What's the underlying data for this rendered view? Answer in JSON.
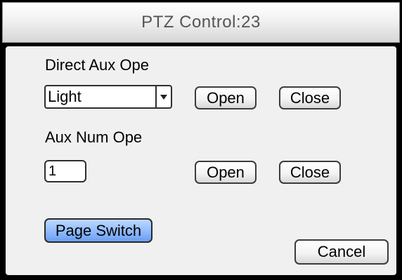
{
  "window": {
    "title": "PTZ Control:23"
  },
  "direct_aux": {
    "heading": "Direct Aux Ope",
    "selected_value": "Light",
    "open_label": "Open",
    "close_label": "Close"
  },
  "aux_num": {
    "heading": "Aux Num Ope",
    "number_value": "1",
    "open_label": "Open",
    "close_label": "Close"
  },
  "footer": {
    "page_switch_label": "Page Switch",
    "cancel_label": "Cancel"
  },
  "colors": {
    "highlight": "#8fbaff",
    "frame": "#000000",
    "panel": "#f0f0f0"
  },
  "icons": {
    "dropdown": "chevron-down-icon"
  }
}
